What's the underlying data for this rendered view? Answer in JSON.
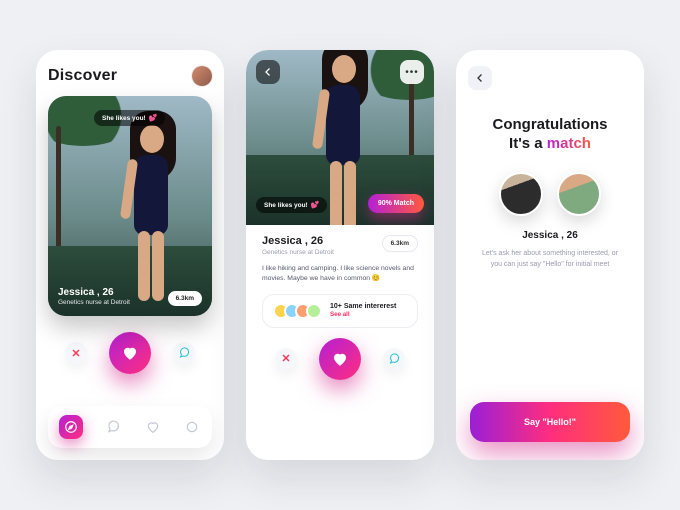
{
  "colors": {
    "gradient_start": "#b51fd6",
    "gradient_mid": "#ff2e7e",
    "gradient_end": "#ff5a3c"
  },
  "screen1": {
    "title": "Discover",
    "likes_you_label": "She likes you!",
    "name_line": "Jessica , 26",
    "subtitle": "Genetics nurse at Detroit",
    "distance": "6.3km"
  },
  "screen2": {
    "likes_you_label": "She likes you!",
    "match_pct": "90% Match",
    "name_line": "Jessica , 26",
    "subtitle": "Genetics nurse at Detroit",
    "distance": "6.3km",
    "bio": "I like hiking and camping. I like science novels and movies. Maybe we have in common 😊",
    "interests_label": "10+ Same intererest",
    "see_all": "See all"
  },
  "screen3": {
    "line1": "Congratulations",
    "line2_prefix": "It's a ",
    "line2_match": "match",
    "name_line": "Jessica , 26",
    "message": "Let's ask her about something interested, or you can just say \"Hello\" for initial meet",
    "cta": "Say \"Hello!\""
  }
}
